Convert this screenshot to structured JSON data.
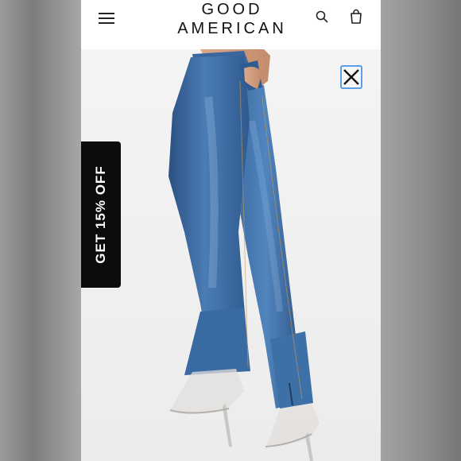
{
  "header": {
    "logo_line1": "GOOD",
    "logo_line2": "AMERICAN",
    "menu_icon": "hamburger-menu-icon",
    "search_icon": "search-icon",
    "bag_icon": "shopping-bag-icon"
  },
  "promo": {
    "label": "GET 15% OFF"
  },
  "popup": {
    "close_icon": "close-icon"
  },
  "colors": {
    "header_bg": "#ffffff",
    "promo_bg": "#0c0c0c",
    "close_border": "#5aa0e6",
    "denim": "#3e6ea6"
  }
}
